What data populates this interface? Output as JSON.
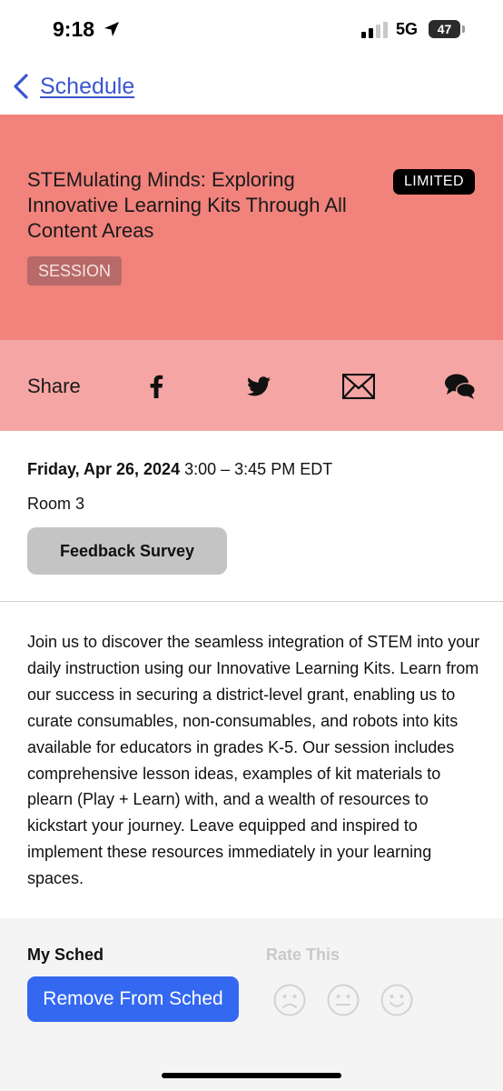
{
  "status_bar": {
    "time": "9:18",
    "network": "5G",
    "battery": "47"
  },
  "nav": {
    "back_label": "Schedule"
  },
  "session": {
    "title": "STEMulating Minds: Exploring Innovative Learning Kits Through All Content Areas",
    "limited_badge": "LIMITED",
    "type_badge": "SESSION",
    "color": "#f2827c"
  },
  "share": {
    "label": "Share",
    "icons": [
      "facebook-icon",
      "twitter-icon",
      "email-icon",
      "chat-icon"
    ]
  },
  "details": {
    "date": "Friday, Apr 26, 2024",
    "time_range": "3:00 – 3:45 PM EDT",
    "room": "Room 3",
    "survey_button": "Feedback Survey"
  },
  "description": "Join us to discover the seamless integration of STEM into your daily instruction using our Innovative Learning Kits. Learn from our success in securing a district-level grant, enabling us to curate consumables, non-consumables, and robots into kits available for educators in grades K-5. Our session includes comprehensive lesson ideas, examples of kit materials to plearn (Play + Learn) with, and a wealth of resources to kickstart your journey. Leave equipped and inspired to implement these resources immediately in your learning spaces.",
  "bottom": {
    "my_sched_label": "My Sched",
    "rate_label": "Rate This",
    "remove_button": "Remove From Sched",
    "accent": "#3468f0",
    "rating_icons": [
      "sad-face-icon",
      "neutral-face-icon",
      "happy-face-icon"
    ]
  }
}
